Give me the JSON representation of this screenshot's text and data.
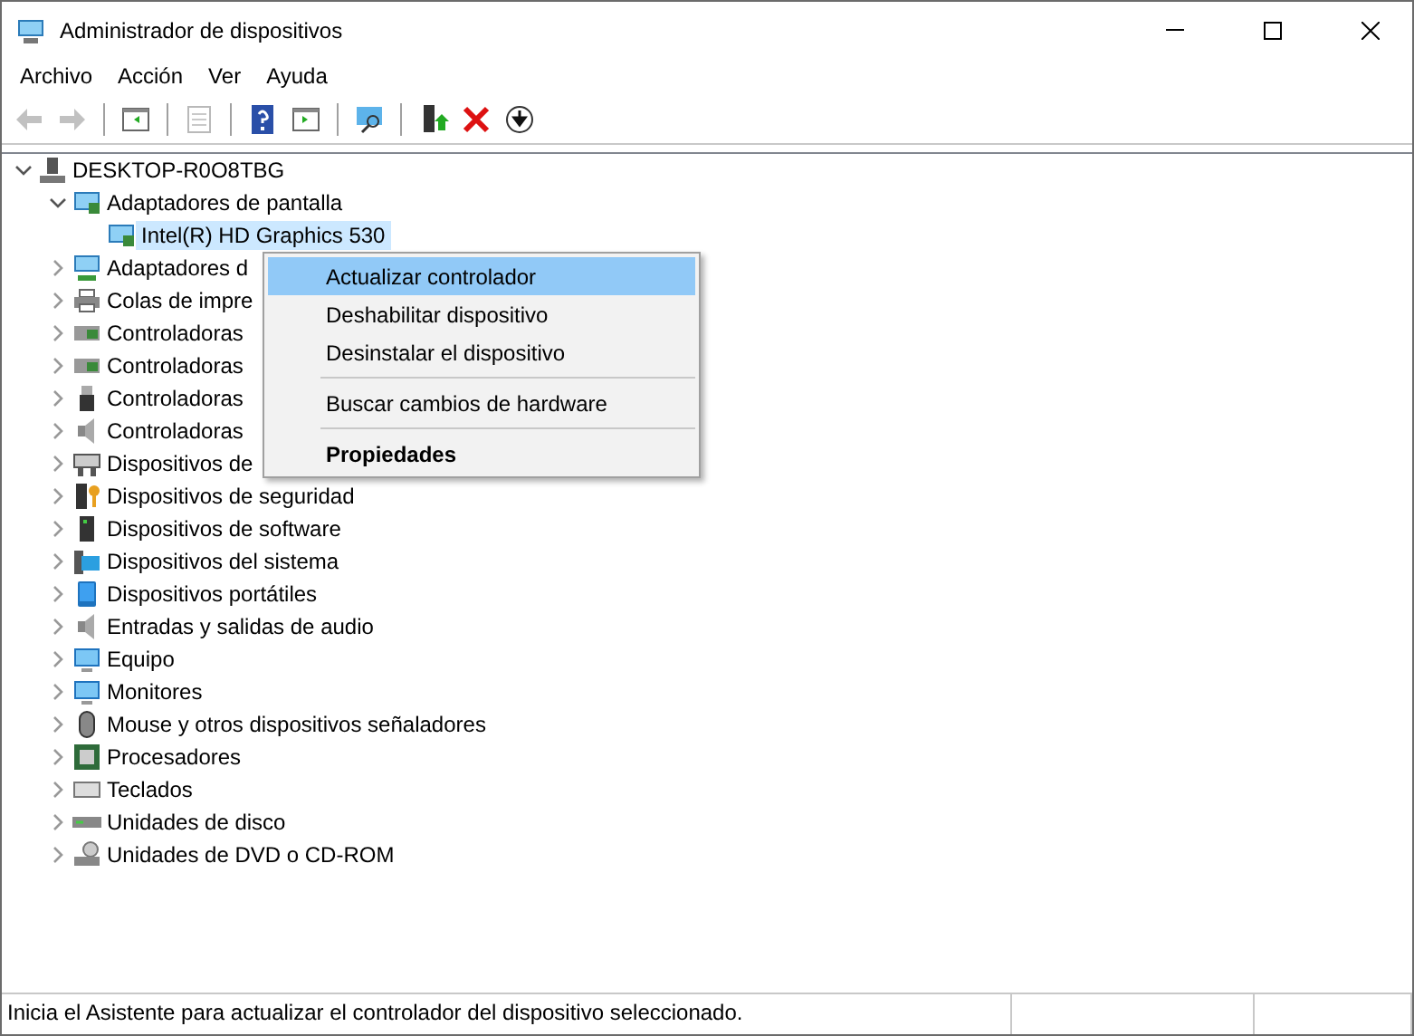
{
  "window": {
    "title": "Administrador de dispositivos"
  },
  "menu_bar": [
    "Archivo",
    "Acción",
    "Ver",
    "Ayuda"
  ],
  "toolbar": [
    {
      "kind": "back",
      "disabled": true
    },
    {
      "kind": "forward",
      "disabled": true
    },
    {
      "kind": "sep"
    },
    {
      "kind": "pane",
      "disabled": false
    },
    {
      "kind": "sep"
    },
    {
      "kind": "doc",
      "disabled": true
    },
    {
      "kind": "sep"
    },
    {
      "kind": "help",
      "disabled": false
    },
    {
      "kind": "pane2",
      "disabled": false
    },
    {
      "kind": "sep"
    },
    {
      "kind": "scan",
      "disabled": false
    },
    {
      "kind": "sep"
    },
    {
      "kind": "update",
      "disabled": false
    },
    {
      "kind": "remove",
      "disabled": false
    },
    {
      "kind": "download",
      "disabled": false
    }
  ],
  "tree": [
    {
      "label": "DESKTOP-R0O8TBG",
      "kind": "computer",
      "expanded": true,
      "selected": false,
      "children": [
        {
          "label": "Adaptadores de pantalla",
          "kind": "display",
          "expanded": true,
          "selected": false,
          "children": [
            {
              "label": "Intel(R) HD Graphics 530",
              "kind": "display",
              "selected": true
            }
          ]
        },
        {
          "label": "Adaptadores d",
          "kind": "network",
          "expanded": false,
          "selected": false
        },
        {
          "label": "Colas de impre",
          "kind": "printer",
          "expanded": false,
          "selected": false
        },
        {
          "label": "Controladoras",
          "kind": "storage",
          "expanded": false,
          "selected": false
        },
        {
          "label": "Controladoras",
          "kind": "storage",
          "expanded": false,
          "selected": false
        },
        {
          "label": "Controladoras",
          "kind": "usb",
          "expanded": false,
          "selected": false
        },
        {
          "label": "Controladoras",
          "kind": "speaker",
          "expanded": false,
          "selected": false
        },
        {
          "label": "Dispositivos de",
          "kind": "hid",
          "expanded": false,
          "selected": false
        },
        {
          "label": "Dispositivos de seguridad",
          "kind": "security",
          "expanded": false,
          "selected": false
        },
        {
          "label": "Dispositivos de software",
          "kind": "tower",
          "expanded": false,
          "selected": false
        },
        {
          "label": "Dispositivos del sistema",
          "kind": "system",
          "expanded": false,
          "selected": false
        },
        {
          "label": "Dispositivos portátiles",
          "kind": "portable",
          "expanded": false,
          "selected": false
        },
        {
          "label": "Entradas y salidas de audio",
          "kind": "speaker",
          "expanded": false,
          "selected": false
        },
        {
          "label": "Equipo",
          "kind": "monitor",
          "expanded": false,
          "selected": false
        },
        {
          "label": "Monitores",
          "kind": "monitor",
          "expanded": false,
          "selected": false
        },
        {
          "label": "Mouse y otros dispositivos señaladores",
          "kind": "mouse",
          "expanded": false,
          "selected": false
        },
        {
          "label": "Procesadores",
          "kind": "cpu",
          "expanded": false,
          "selected": false
        },
        {
          "label": "Teclados",
          "kind": "keyboard",
          "expanded": false,
          "selected": false
        },
        {
          "label": "Unidades de disco",
          "kind": "disk",
          "expanded": false,
          "selected": false
        },
        {
          "label": "Unidades de DVD o CD-ROM",
          "kind": "dvd",
          "expanded": false,
          "selected": false
        }
      ]
    }
  ],
  "context_menu": [
    {
      "kind": "item",
      "label": "Actualizar controlador",
      "selected": true,
      "bold": false
    },
    {
      "kind": "item",
      "label": "Deshabilitar dispositivo",
      "selected": false,
      "bold": false
    },
    {
      "kind": "item",
      "label": "Desinstalar el dispositivo",
      "selected": false,
      "bold": false
    },
    {
      "kind": "separator"
    },
    {
      "kind": "item",
      "label": "Buscar cambios de hardware",
      "selected": false,
      "bold": false
    },
    {
      "kind": "separator"
    },
    {
      "kind": "item",
      "label": "Propiedades",
      "selected": false,
      "bold": true
    }
  ],
  "status_bar": "Inicia el Asistente para actualizar el controlador del dispositivo seleccionado."
}
